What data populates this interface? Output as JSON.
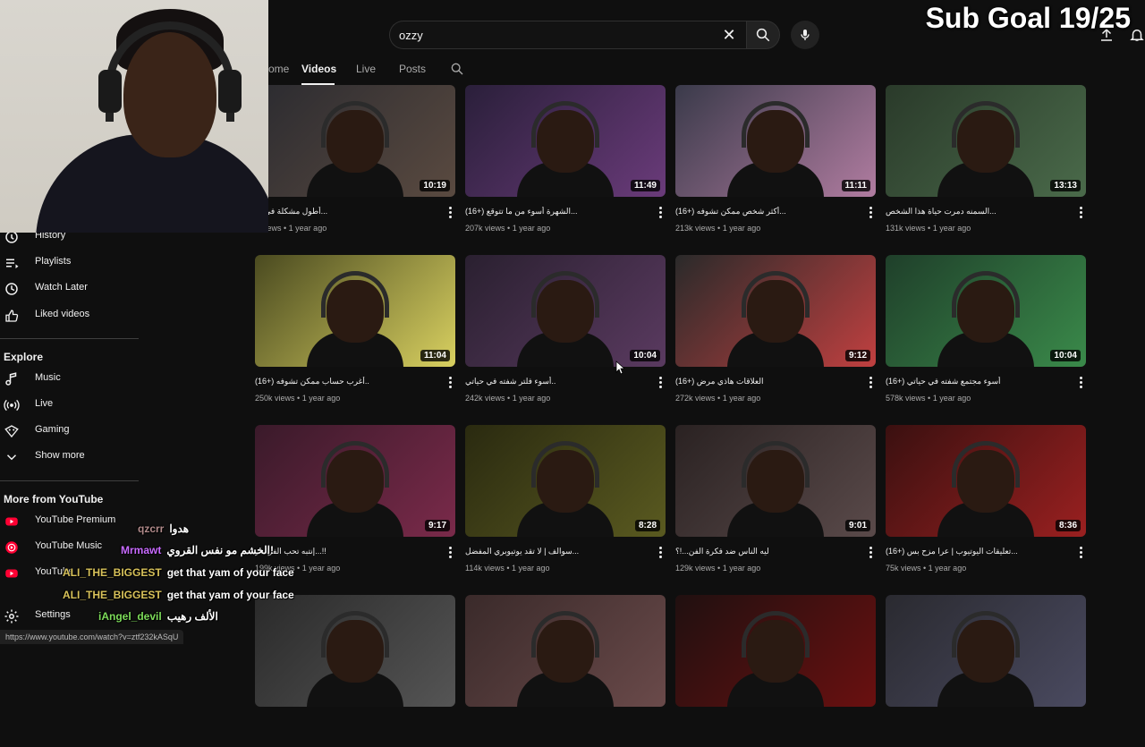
{
  "search": {
    "value": "ozzy"
  },
  "overlay": {
    "sub_goal": "Sub Goal 19/25"
  },
  "tabs": [
    {
      "label": "ome"
    },
    {
      "label": "Videos"
    },
    {
      "label": "Live"
    },
    {
      "label": "Posts"
    }
  ],
  "sidebar": {
    "you_items": [
      {
        "label": "History",
        "icon": "history-icon"
      },
      {
        "label": "Playlists",
        "icon": "playlists-icon"
      },
      {
        "label": "Watch Later",
        "icon": "clock-icon"
      },
      {
        "label": "Liked videos",
        "icon": "thumbs-up-icon"
      }
    ],
    "explore_heading": "Explore",
    "explore_items": [
      {
        "label": "Music",
        "icon": "music-note-icon"
      },
      {
        "label": "Live",
        "icon": "live-icon"
      },
      {
        "label": "Gaming",
        "icon": "gaming-icon"
      },
      {
        "label": "Show more",
        "icon": "chevron-down-icon"
      }
    ],
    "more_heading": "More from YouTube",
    "more_items": [
      {
        "label": "YouTube Premium",
        "icon": "youtube-premium-icon"
      },
      {
        "label": "YouTube Music",
        "icon": "youtube-music-icon"
      },
      {
        "label": "YouTube",
        "icon": "youtube-kids-icon"
      }
    ],
    "settings_label": "Settings"
  },
  "videos": [
    {
      "title": "أطول مشكلة في الـ...",
      "views": "k views",
      "age": "1 year ago",
      "duration": "10:19"
    },
    {
      "title": "(16+) الشهرة أسوء من ما تتوقع...",
      "views": "207k views",
      "age": "1 year ago",
      "duration": "11:49"
    },
    {
      "title": "(16+) أكثر شخص ممكن تشوفه...",
      "views": "213k views",
      "age": "1 year ago",
      "duration": "11:11"
    },
    {
      "title": "السمنه دمرت حياة هذا الشخص...",
      "views": "131k views",
      "age": "1 year ago",
      "duration": "13:13"
    },
    {
      "title": "(16+) أغرب حساب ممكن تشوفه..",
      "views": "250k views",
      "age": "1 year ago",
      "duration": "11:04"
    },
    {
      "title": "أسوء فلتر شفته في حياتي..",
      "views": "242k views",
      "age": "1 year ago",
      "duration": "10:04"
    },
    {
      "title": "(16+) العلاقات هاذي مرض",
      "views": "272k views",
      "age": "1 year ago",
      "duration": "9:12"
    },
    {
      "title": "(16+) أسوء مجتمع شفته في حياتي",
      "views": "578k views",
      "age": "1 year ago",
      "duration": "10:04"
    },
    {
      "title": "إنتبه تحب الفراسر...!!",
      "views": "199k views",
      "age": "1 year ago",
      "duration": "9:17"
    },
    {
      "title": "سوالف | لا تقد يوتيوبري المفضل...",
      "views": "114k views",
      "age": "1 year ago",
      "duration": "8:28"
    },
    {
      "title": "ليه الناس ضد فكرة الفن...!؟",
      "views": "129k views",
      "age": "1 year ago",
      "duration": "9:01"
    },
    {
      "title": "(16+) تعليقات اليوتيوب | عرا مزح بس...",
      "views": "75k views",
      "age": "1 year ago",
      "duration": "8:36"
    },
    {
      "title": "",
      "views": "",
      "age": "",
      "duration": ""
    },
    {
      "title": "",
      "views": "",
      "age": "",
      "duration": ""
    },
    {
      "title": "",
      "views": "",
      "age": "",
      "duration": ""
    },
    {
      "title": "",
      "views": "",
      "age": "",
      "duration": ""
    }
  ],
  "chat": [
    {
      "user": "qzcrr",
      "message": "هدوا",
      "color": "#b08a8a"
    },
    {
      "user": "Mrmawt",
      "message": "الخشم مو نفس القروي!",
      "color": "#c86bff"
    },
    {
      "user": "ALI_THE_BIGGEST",
      "message": "get that yam of your face",
      "color": "#d8c25a"
    },
    {
      "user": "ALI_THE_BIGGEST",
      "message": "get that yam of your face",
      "color": "#d8c25a"
    },
    {
      "user": "iAngel_devil",
      "message": "الألف رهيب",
      "color": "#7ddc5a"
    }
  ],
  "status_url": "https://www.youtube.com/watch?v=ztf232kASqU",
  "colors": {
    "background": "#0f0f0f",
    "accent_red": "#ff0033"
  }
}
